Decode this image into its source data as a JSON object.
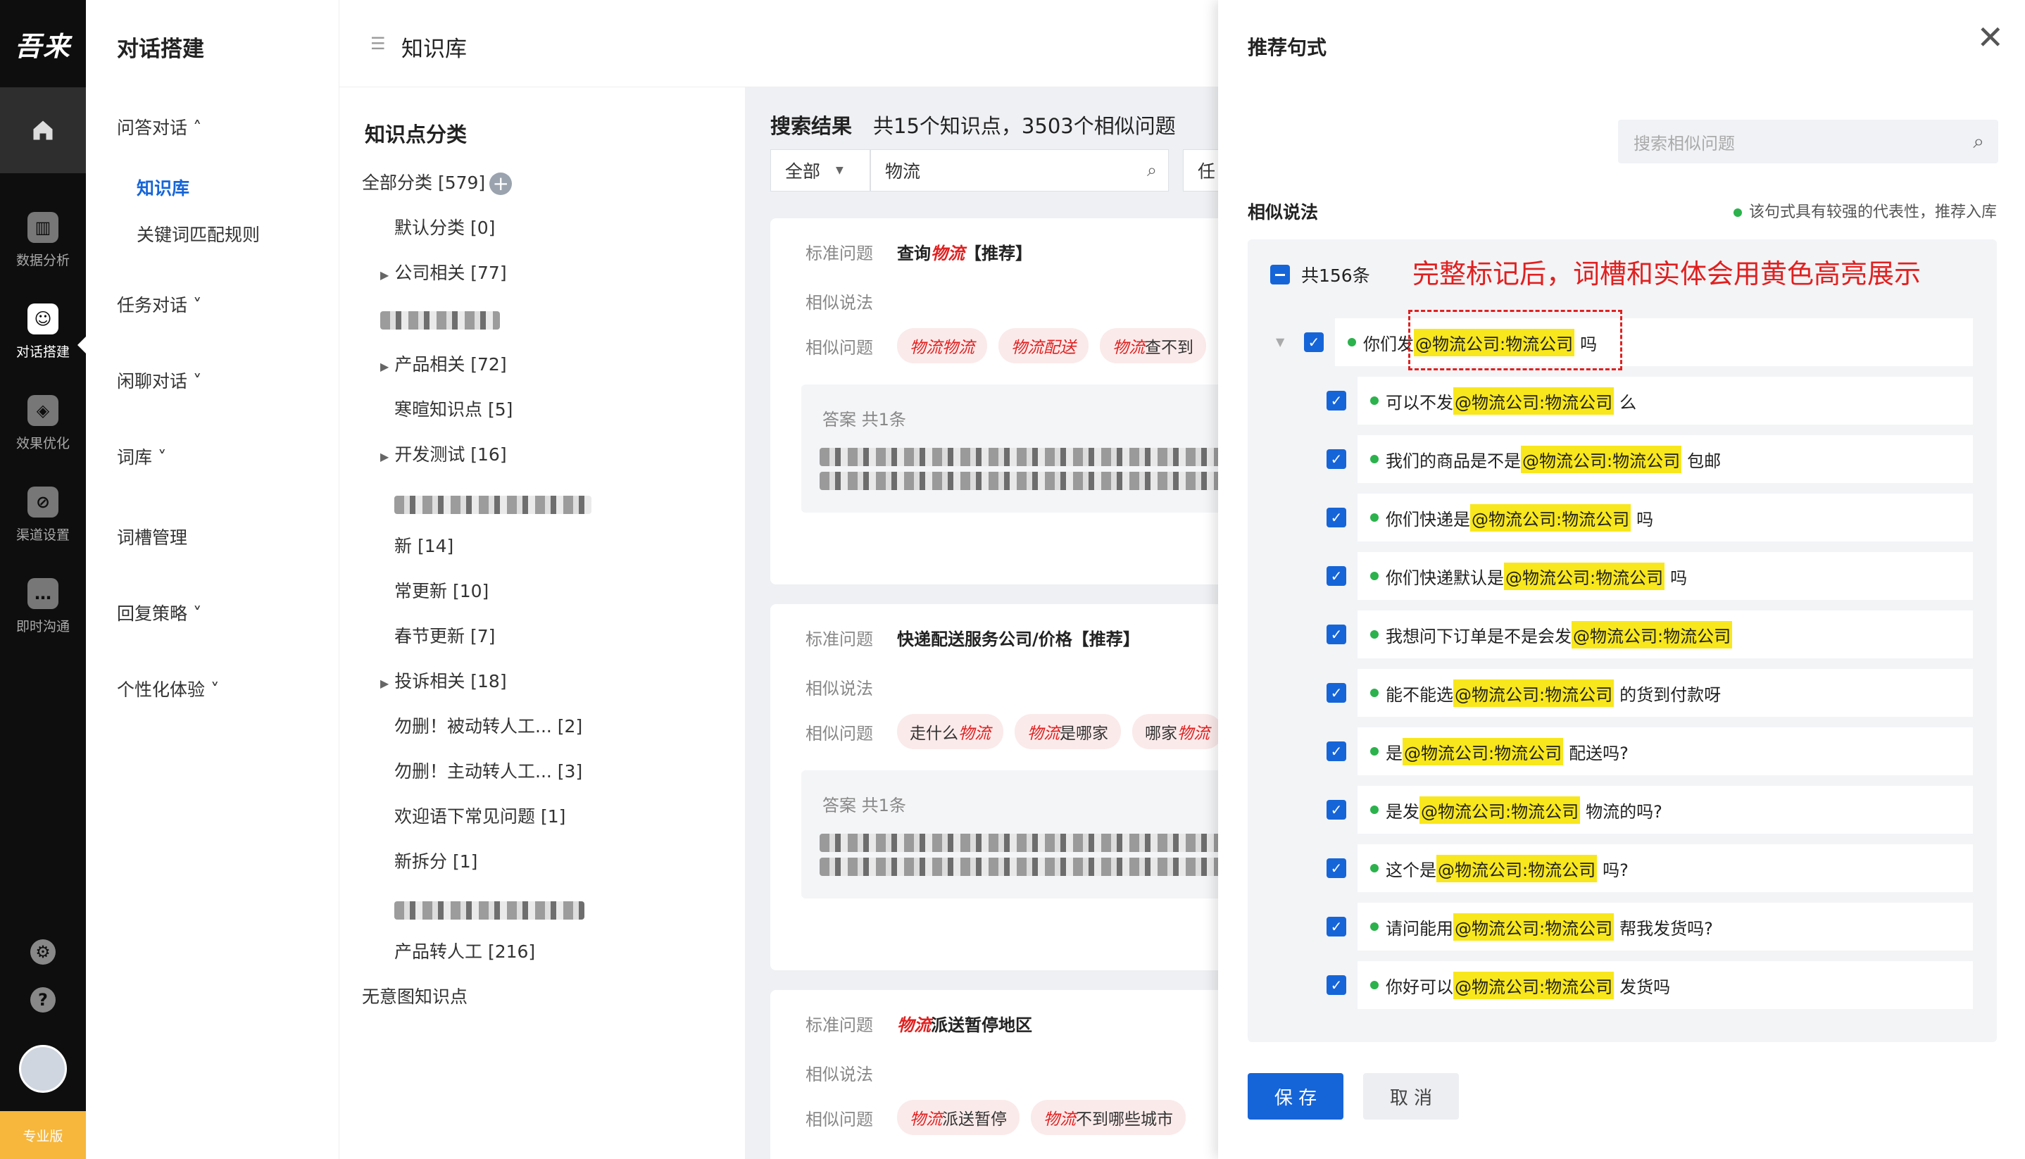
{
  "rail": {
    "logo": "吾来",
    "items": [
      "数据分析",
      "对话搭建",
      "效果优化",
      "渠道设置",
      "即时沟通"
    ],
    "plan": "专业版"
  },
  "nav": {
    "title": "对话搭建",
    "qa": "问答对话 ˄",
    "qa_subs": [
      "知识库",
      "关键词匹配规则"
    ],
    "items": [
      "任务对话 ˅",
      "闲聊对话 ˅",
      "词库 ˅",
      "词槽管理",
      "回复策略 ˅",
      "个性化体验 ˅"
    ]
  },
  "topbar": {
    "title": "知识库"
  },
  "categories": {
    "title": "知识点分类",
    "all": "全部分类 [579]",
    "rows": [
      "默认分类 [0]",
      "公司相关 [77]",
      "产品相关 [72]",
      "寒暄知识点 [5]",
      "开发测试 [16]",
      "新 [14]",
      "常更新 [10]",
      "春节更新 [7]",
      "投诉相关 [18]",
      "勿删！被动转人工... [2]",
      "勿删！主动转人工... [3]",
      "欢迎语下常见问题 [1]",
      "新拆分 [1]",
      "产品转人工 [216]",
      "无意图知识点"
    ]
  },
  "results": {
    "label": "搜索结果",
    "summary": "共15个知识点，3503个相似问题",
    "filter_all": "全部",
    "search_value": "物流",
    "filter_extra": "任",
    "labels": {
      "std": "标准问题",
      "similar": "相似说法",
      "similar_q": "相似问题",
      "answer": "答案 共1条"
    },
    "cards": [
      {
        "pre": "查询",
        "kw": "物流",
        "post": "【推荐】",
        "tags": [
          [
            "物流",
            "物流"
          ],
          [
            "物流",
            "配送"
          ],
          [
            "物流",
            "查不到"
          ]
        ]
      },
      {
        "pre": "快递配送服务公司/价格【推荐】",
        "kw": "",
        "post": "",
        "tags": [
          [
            "走什么",
            "物流"
          ],
          [
            "物流",
            "是哪家"
          ],
          [
            "哪家",
            "物流"
          ]
        ]
      },
      {
        "pre": "",
        "kw": "物流",
        "post": "派送暂停地区",
        "tags": [
          [
            "物流",
            "派送暂停"
          ],
          [
            "物流",
            "不到哪些城市"
          ]
        ]
      }
    ]
  },
  "drawer": {
    "title": "推荐句式",
    "close": "✕",
    "search_placeholder": "搜索相似问题",
    "section": "相似说法",
    "hint": "该句式具有较强的代表性，推荐入库",
    "count": "共156条",
    "annotation": "完整标记后，词槽和实体会用黄色高亮展示",
    "entity": "@物流公司:物流公司",
    "phrases": [
      {
        "pre": "你们发",
        "post": "吗"
      },
      {
        "pre": "可以不发",
        "post": "么"
      },
      {
        "pre": "我们的商品是不是",
        "post": "包邮"
      },
      {
        "pre": "你们快递是",
        "post": "吗"
      },
      {
        "pre": "你们快递默认是",
        "post": "吗"
      },
      {
        "pre": "我想问下订单是不是会发",
        "post": ""
      },
      {
        "pre": "能不能选",
        "post": "的货到付款呀"
      },
      {
        "pre": "是",
        "post": "配送吗?"
      },
      {
        "pre": "是发",
        "post": "物流的吗?"
      },
      {
        "pre": "这个是",
        "post": "吗?"
      },
      {
        "pre": "请问能用",
        "post": "帮我发货吗?"
      },
      {
        "pre": "你好可以",
        "post": "发货吗"
      }
    ],
    "save": "保 存",
    "cancel": "取 消"
  },
  "colors": {
    "primary": "#1665d8",
    "highlight": "#f8e71c",
    "keyword": "#e02020",
    "rail": "#0e0e0e"
  }
}
